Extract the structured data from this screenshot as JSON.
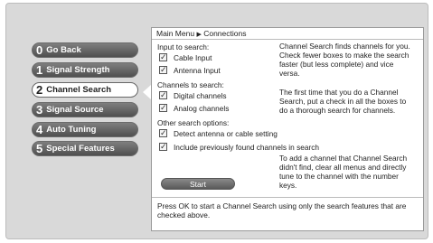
{
  "menu": [
    {
      "num": "0",
      "label": "Go Back"
    },
    {
      "num": "1",
      "label": "Signal Strength"
    },
    {
      "num": "2",
      "label": "Channel Search"
    },
    {
      "num": "3",
      "label": "Signal Source"
    },
    {
      "num": "4",
      "label": "Auto Tuning"
    },
    {
      "num": "5",
      "label": "Special Features"
    }
  ],
  "breadcrumb": {
    "root": "Main Menu",
    "separator": "▶",
    "current": "Connections"
  },
  "input_section": {
    "heading": "Input to search:",
    "cable": {
      "label": "Cable Input",
      "checked": true
    },
    "antenna": {
      "label": "Antenna Input",
      "checked": true
    }
  },
  "channel_section": {
    "heading": "Channels to search:",
    "digital": {
      "label": "Digital channels",
      "checked": true
    },
    "analog": {
      "label": "Analog channels",
      "checked": true
    }
  },
  "other_section": {
    "heading": "Other search options:",
    "detect": {
      "label": "Detect antenna or cable setting",
      "checked": true
    },
    "include": {
      "label": "Include previously found channels in search",
      "checked": true
    }
  },
  "help": {
    "p1": "Channel Search finds channels for you. Check fewer boxes to make the search faster (but less complete) and vice versa.",
    "p2": "The first time that you do a Channel Search, put a check in all the boxes to do a thorough search for channels.",
    "p3": "To add a channel that Channel Search didn't find, clear all menus and directly tune to the channel with the number keys."
  },
  "start_label": "Start",
  "footer": "Press OK to start a Channel Search using only the search features that are checked above.",
  "check_mark": "✓",
  "colors": {
    "button_dark": "#5a5a5a",
    "panel": "#ffffff",
    "background": "#d9d9d9"
  }
}
